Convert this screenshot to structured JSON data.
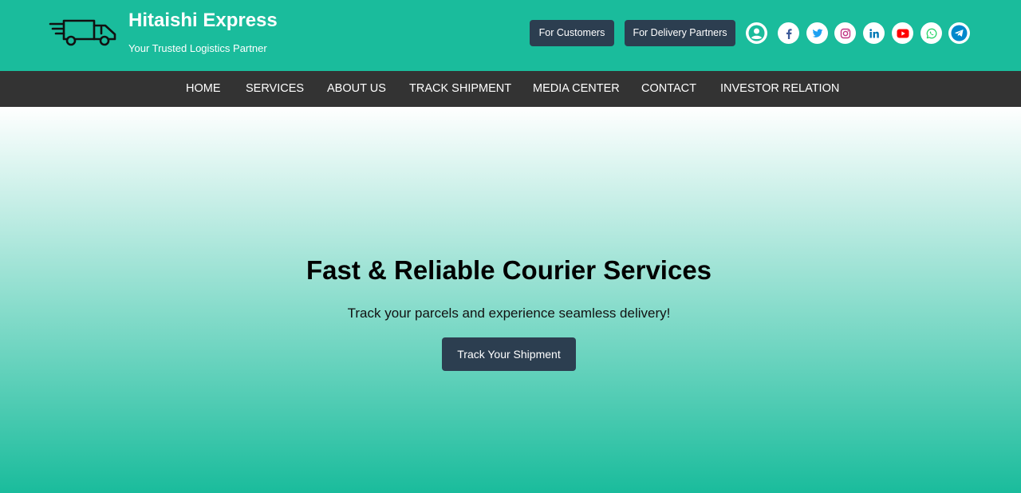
{
  "brand": {
    "title": "Hitaishi Express",
    "tagline": "Your Trusted Logistics Partner",
    "logo_icon": "delivery-truck-icon"
  },
  "header": {
    "customers_label": "For Customers",
    "partners_label": "For Delivery Partners",
    "icons": [
      "user-icon",
      "facebook-icon",
      "twitter-icon",
      "instagram-icon",
      "linkedin-icon",
      "youtube-icon",
      "whatsapp-icon",
      "telegram-icon"
    ]
  },
  "nav": {
    "items": [
      "HOME",
      "SERVICES",
      "ABOUT US",
      "TRACK SHIPMENT",
      "MEDIA CENTER",
      "CONTACT",
      "INVESTOR RELATION"
    ]
  },
  "hero": {
    "title": "Fast & Reliable Courier Services",
    "subtitle": "Track your parcels and experience seamless delivery!",
    "button_label": "Track Your Shipment"
  },
  "colors": {
    "primary": "#1abc9c",
    "button_dark": "#2c3e50",
    "navbar": "#333333",
    "facebook": "#3b5998",
    "twitter": "#1da1f2",
    "instagram": "#c13584",
    "linkedin": "#0077b5",
    "youtube": "#ff0000",
    "whatsapp": "#25d366",
    "telegram": "#0088cc"
  }
}
